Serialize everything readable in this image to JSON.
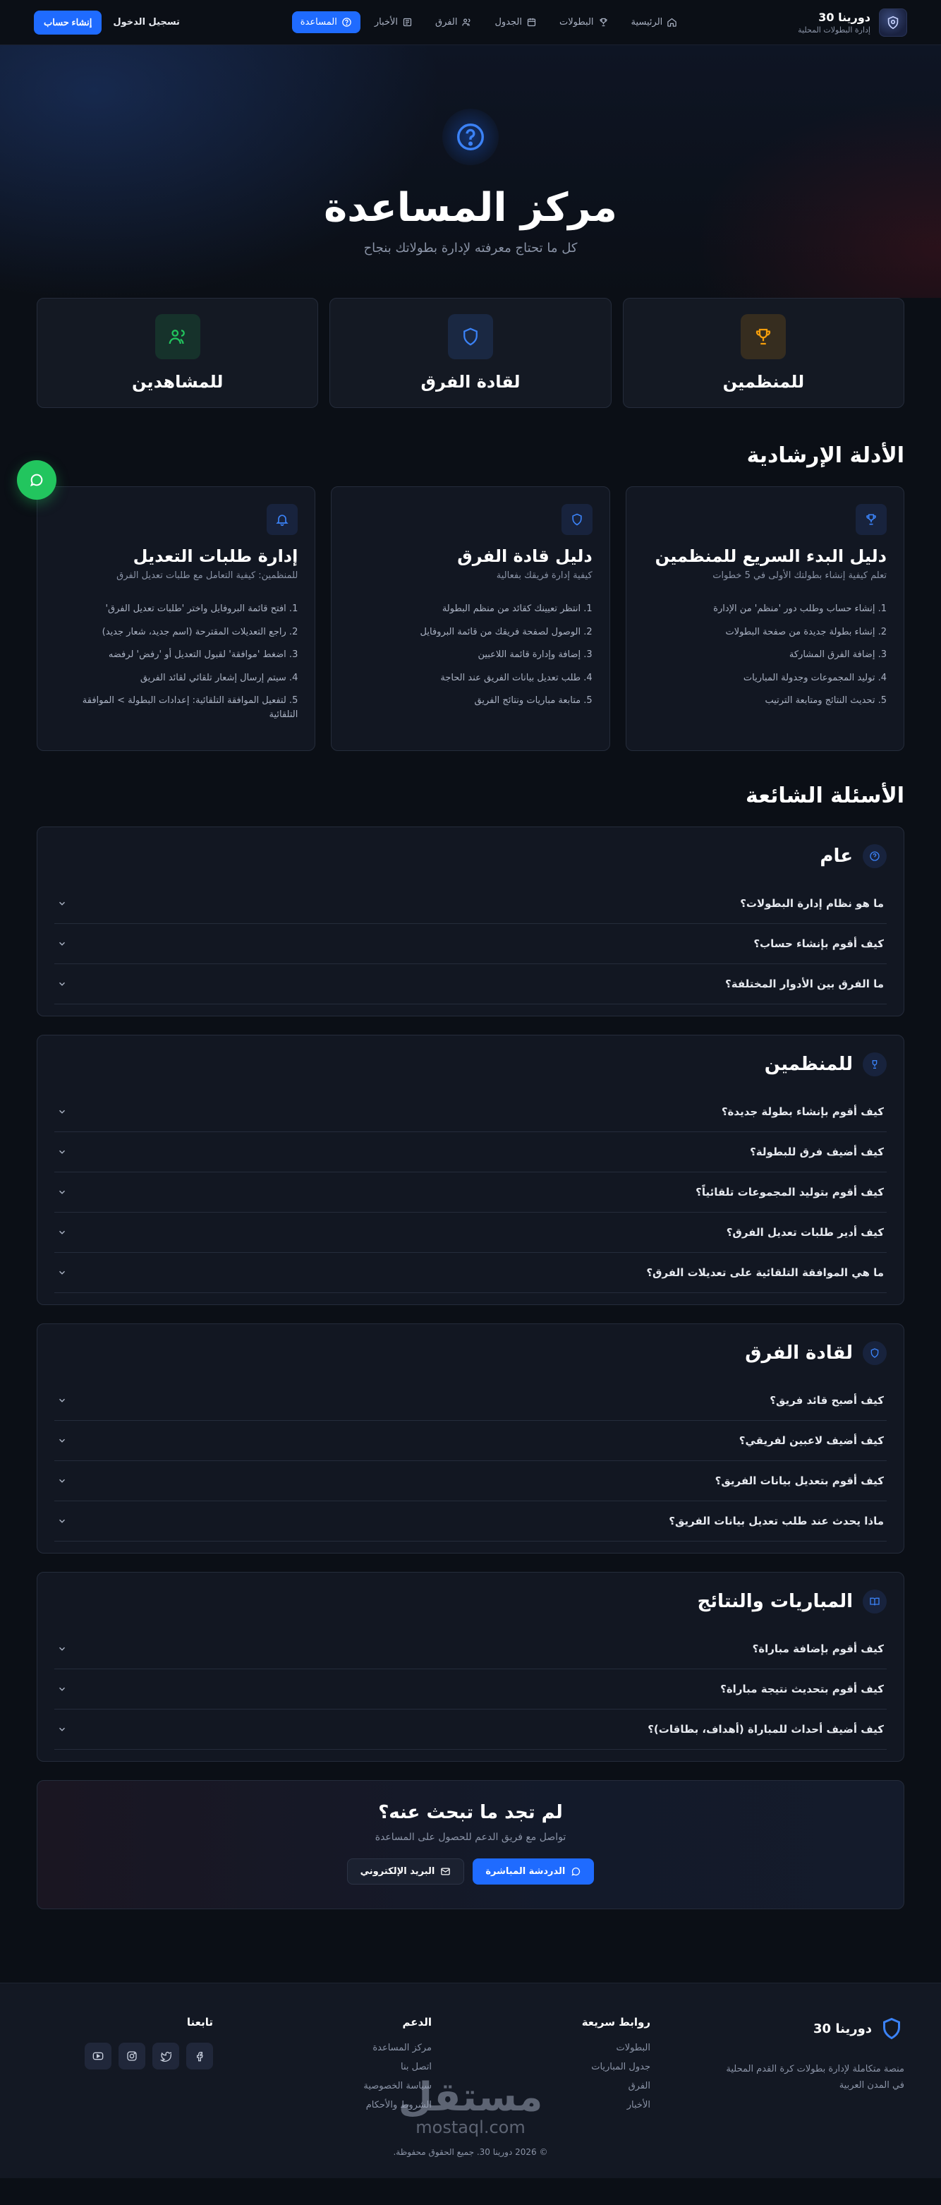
{
  "brand": {
    "name": "دورينا 30",
    "tagline": "إدارة البطولات المحلية"
  },
  "nav": {
    "items": [
      {
        "label": "الرئيسية",
        "icon": "home-icon"
      },
      {
        "label": "البطولات",
        "icon": "trophy-icon"
      },
      {
        "label": "الجدول",
        "icon": "calendar-icon"
      },
      {
        "label": "الفرق",
        "icon": "users-icon"
      },
      {
        "label": "الأخبار",
        "icon": "newspaper-icon"
      },
      {
        "label": "المساعدة",
        "icon": "help-circle-icon",
        "active": true
      }
    ],
    "login": "تسجيل الدخول",
    "signup": "إنشاء حساب"
  },
  "hero": {
    "title": "مركز المساعدة",
    "subtitle": "كل ما تحتاج معرفته لإدارة بطولاتك بنجاح"
  },
  "audiences": [
    {
      "label": "للمنظمين",
      "icon": "trophy-icon",
      "color": "#f59e0b"
    },
    {
      "label": "لقادة الفرق",
      "icon": "shield-icon",
      "color": "#3b82f6"
    },
    {
      "label": "للمشاهدين",
      "icon": "users-icon",
      "color": "#22c55e"
    }
  ],
  "guides": {
    "title": "الأدلة الإرشادية",
    "items": [
      {
        "title": "دليل البدء السريع للمنظمين",
        "desc": "تعلم كيفية إنشاء بطولتك الأولى في 5 خطوات",
        "icon": "trophy-icon",
        "steps": [
          "1. إنشاء حساب وطلب دور 'منظم' من الإدارة",
          "2. إنشاء بطولة جديدة من صفحة البطولات",
          "3. إضافة الفرق المشاركة",
          "4. توليد المجموعات وجدولة المباريات",
          "5. تحديث النتائج ومتابعة الترتيب"
        ]
      },
      {
        "title": "دليل قادة الفرق",
        "desc": "كيفية إدارة فريقك بفعالية",
        "icon": "shield-icon",
        "steps": [
          "1. انتظر تعيينك كقائد من منظم البطولة",
          "2. الوصول لصفحة فريقك من قائمة البروفايل",
          "3. إضافة وإدارة قائمة اللاعبين",
          "4. طلب تعديل بيانات الفريق عند الحاجة",
          "5. متابعة مباريات ونتائج الفريق"
        ]
      },
      {
        "title": "إدارة طلبات التعديل",
        "desc": "للمنظمين: كيفية التعامل مع طلبات تعديل الفرق",
        "icon": "bell-icon",
        "steps": [
          "1. افتح قائمة البروفايل واختر 'طلبات تعديل الفرق'",
          "2. راجع التعديلات المقترحة (اسم جديد، شعار جديد)",
          "3. اضغط 'موافقة' لقبول التعديل أو 'رفض' لرفضه",
          "4. سيتم إرسال إشعار تلقائي لقائد الفريق",
          "5. لتفعيل الموافقة التلقائية: إعدادات البطولة > الموافقة التلقائية"
        ]
      }
    ]
  },
  "faq": {
    "title": "الأسئلة الشائعة",
    "groups": [
      {
        "title": "عام",
        "icon": "help-circle-icon",
        "questions": [
          "ما هو نظام إدارة البطولات؟",
          "كيف أقوم بإنشاء حساب؟",
          "ما الفرق بين الأدوار المختلفة؟"
        ]
      },
      {
        "title": "للمنظمين",
        "icon": "trophy-icon",
        "questions": [
          "كيف أقوم بإنشاء بطولة جديدة؟",
          "كيف أضيف فرق للبطولة؟",
          "كيف أقوم بتوليد المجموعات تلقائياً؟",
          "كيف أدير طلبات تعديل الفرق؟",
          "ما هي الموافقة التلقائية على تعديلات الفرق؟"
        ]
      },
      {
        "title": "لقادة الفرق",
        "icon": "shield-icon",
        "questions": [
          "كيف أصبح قائد فريق؟",
          "كيف أضيف لاعبين لفريقي؟",
          "كيف أقوم بتعديل بيانات الفريق؟",
          "ماذا يحدث عند طلب تعديل بيانات الفريق؟"
        ]
      },
      {
        "title": "المباريات والنتائج",
        "icon": "book-icon",
        "questions": [
          "كيف أقوم بإضافة مباراة؟",
          "كيف أقوم بتحديث نتيجة مباراة؟",
          "كيف أضيف أحداث للمباراة (أهداف، بطاقات)؟"
        ]
      }
    ]
  },
  "cta": {
    "title": "لم تجد ما تبحث عنه؟",
    "subtitle": "تواصل مع فريق الدعم للحصول على المساعدة",
    "chat": "الدردشة المباشرة",
    "email": "البريد الإلكتروني"
  },
  "footer": {
    "brand_name": "دورينا 30",
    "brand_desc": "منصة متكاملة لإدارة بطولات كرة القدم المحلية في المدن العربية",
    "quick_links": {
      "title": "روابط سريعة",
      "items": [
        "البطولات",
        "جدول المباريات",
        "الفرق",
        "الأخبار"
      ]
    },
    "support": {
      "title": "الدعم",
      "items": [
        "مركز المساعدة",
        "اتصل بنا",
        "سياسة الخصوصية",
        "الشروط والأحكام"
      ]
    },
    "follow": {
      "title": "تابعنا",
      "icons": [
        "facebook-icon",
        "twitter-icon",
        "instagram-icon",
        "youtube-icon"
      ]
    },
    "copyright": "© 2026 دورينا 30. جميع الحقوق محفوظة."
  },
  "watermark": {
    "arabic": "مستقل",
    "latin": "mostaql.com"
  }
}
